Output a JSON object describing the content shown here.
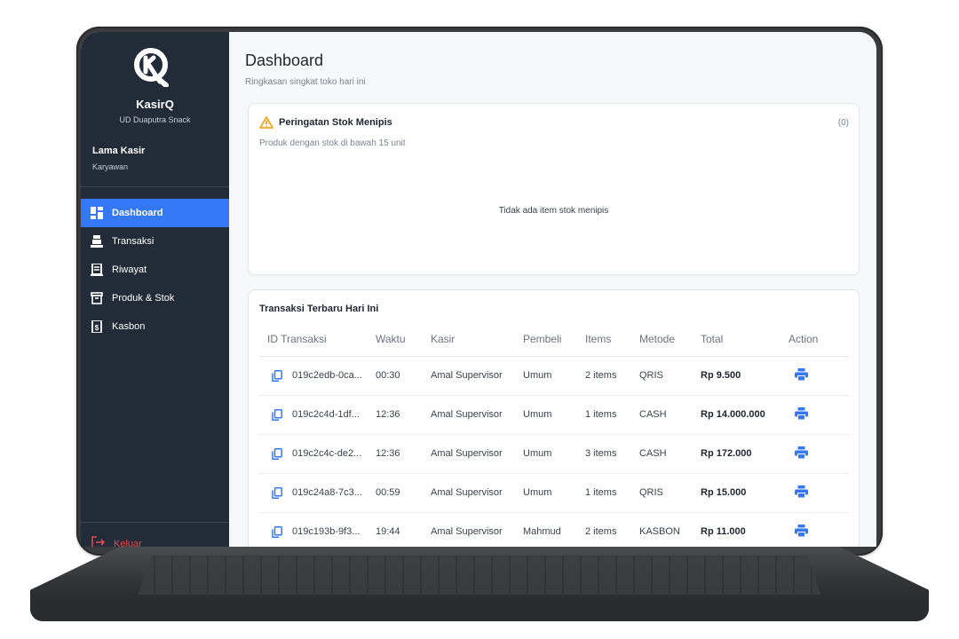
{
  "app": {
    "name": "KasirQ",
    "store": "UD Duaputra Snack",
    "user_name": "Lama Kasir",
    "user_role": "Karyawan"
  },
  "sidebar": {
    "items": [
      {
        "label": "Dashboard",
        "icon": "dashboard-icon",
        "active": true
      },
      {
        "label": "Transaksi",
        "icon": "cash-register-icon",
        "active": false
      },
      {
        "label": "Riwayat",
        "icon": "receipt-icon",
        "active": false
      },
      {
        "label": "Produk & Stok",
        "icon": "archive-box-icon",
        "active": false
      },
      {
        "label": "Kasbon",
        "icon": "ledger-icon",
        "active": false
      }
    ],
    "logout_label": "Keluar"
  },
  "header": {
    "title": "Dashboard",
    "subtitle": "Ringkasan singkat toko hari ini"
  },
  "stock_warning": {
    "title": "Peringatan Stok Menipis",
    "count": "(0)",
    "subtitle": "Produk dengan stok di bawah 15 unit",
    "empty_text": "Tidak ada item stok menipis"
  },
  "transactions": {
    "title": "Transaksi Terbaru Hari Ini",
    "columns": [
      "ID Transaksi",
      "Waktu",
      "Kasir",
      "Pembeli",
      "Items",
      "Metode",
      "Total",
      "Action"
    ],
    "rows": [
      {
        "id": "019c2edb-0ca...",
        "time": "00:30",
        "cashier": "Amal Supervisor",
        "buyer": "Umum",
        "items": "2 items",
        "method": "QRIS",
        "total": "Rp 9.500"
      },
      {
        "id": "019c2c4d-1df...",
        "time": "12:36",
        "cashier": "Amal Supervisor",
        "buyer": "Umum",
        "items": "1 items",
        "method": "CASH",
        "total": "Rp 14.000.000"
      },
      {
        "id": "019c2c4c-de2...",
        "time": "12:36",
        "cashier": "Amal Supervisor",
        "buyer": "Umum",
        "items": "3 items",
        "method": "CASH",
        "total": "Rp 172.000"
      },
      {
        "id": "019c24a8-7c3...",
        "time": "00:59",
        "cashier": "Amal Supervisor",
        "buyer": "Umum",
        "items": "1 items",
        "method": "QRIS",
        "total": "Rp 15.000"
      },
      {
        "id": "019c193b-9f3...",
        "time": "19:44",
        "cashier": "Amal Supervisor",
        "buyer": "Mahmud",
        "items": "2 items",
        "method": "KASBON",
        "total": "Rp 11.000"
      }
    ]
  },
  "colors": {
    "sidebar_bg": "#222b38",
    "accent": "#3478f6",
    "warning": "#f5a623",
    "danger": "#e04b4b"
  }
}
